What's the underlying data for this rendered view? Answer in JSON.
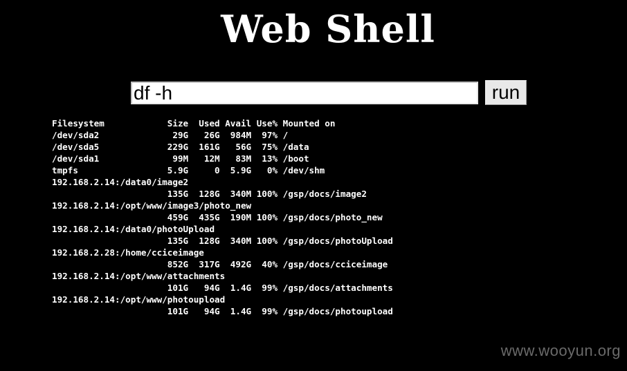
{
  "page": {
    "title": "Web Shell",
    "background_color": "#000000",
    "text_color": "#ffffff"
  },
  "command": {
    "value": "df -h",
    "run_label": "run"
  },
  "output_lines": [
    "Filesystem            Size  Used Avail Use% Mounted on",
    "/dev/sda2              29G   26G  984M  97% /",
    "/dev/sda5             229G  161G   56G  75% /data",
    "/dev/sda1              99M   12M   83M  13% /boot",
    "tmpfs                 5.9G     0  5.9G   0% /dev/shm",
    "192.168.2.14:/data0/image2",
    "                      135G  128G  340M 100% /gsp/docs/image2",
    "192.168.2.14:/opt/www/image3/photo_new",
    "                      459G  435G  190M 100% /gsp/docs/photo_new",
    "192.168.2.14:/data0/photoUpload",
    "                      135G  128G  340M 100% /gsp/docs/photoUpload",
    "192.168.2.28:/home/cciceimage",
    "                      852G  317G  492G  40% /gsp/docs/cciceimage",
    "192.168.2.14:/opt/www/attachments",
    "                      101G   94G  1.4G  99% /gsp/docs/attachments",
    "192.168.2.14:/opt/www/photoupload",
    "                      101G   94G  1.4G  99% /gsp/docs/photoupload"
  ],
  "watermark": "www.wooyun.org"
}
